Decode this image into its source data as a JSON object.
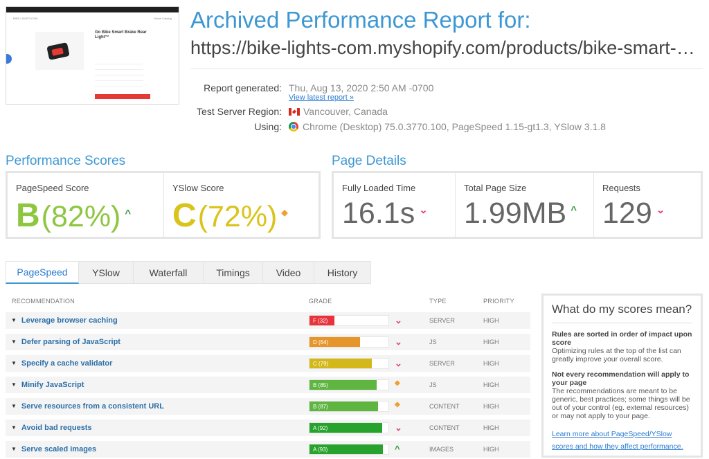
{
  "header": {
    "title": "Archived Performance Report for:",
    "url": "https://bike-lights-com.myshopify.com/products/bike-smart-brake-rear-light",
    "thumbnail": {
      "top_text": "Free shipping for orders over $50",
      "site": "BIKE-LIGHTS.COM",
      "nav": "Home   Catalog",
      "product_title": "Go Bike Smart Brake Rear Light™"
    }
  },
  "meta": {
    "report_generated_label": "Report generated:",
    "report_generated_value": "Thu, Aug 13, 2020 2:50 AM -0700",
    "latest_link": "View latest report »",
    "region_label": "Test Server Region:",
    "region_value": "Vancouver, Canada",
    "using_label": "Using:",
    "using_value": "Chrome (Desktop) 75.0.3770.100, PageSpeed 1.15-gt1.3, YSlow 3.1.8"
  },
  "performance": {
    "title": "Performance Scores",
    "pagespeed": {
      "label": "PageSpeed Score",
      "grade": "B",
      "percent": "(82%)",
      "color": "#8dc63f"
    },
    "yslow": {
      "label": "YSlow Score",
      "grade": "C",
      "percent": "(72%)",
      "color": "#d9c41c"
    }
  },
  "details": {
    "title": "Page Details",
    "loaded": {
      "label": "Fully Loaded Time",
      "value": "16.1s"
    },
    "size": {
      "label": "Total Page Size",
      "value": "1.99MB"
    },
    "requests": {
      "label": "Requests",
      "value": "129"
    }
  },
  "tabs": [
    {
      "label": "PageSpeed",
      "active": true
    },
    {
      "label": "YSlow"
    },
    {
      "label": "Waterfall"
    },
    {
      "label": "Timings"
    },
    {
      "label": "Video"
    },
    {
      "label": "History"
    }
  ],
  "table": {
    "headers": {
      "recommendation": "RECOMMENDATION",
      "grade": "GRADE",
      "type": "TYPE",
      "priority": "PRIORITY"
    },
    "rows": [
      {
        "name": "Leverage browser caching",
        "grade": "F (32)",
        "score": 32,
        "color": "#e8333c",
        "trend": "down",
        "type": "SERVER",
        "priority": "HIGH"
      },
      {
        "name": "Defer parsing of JavaScript",
        "grade": "D (64)",
        "score": 64,
        "color": "#e6952b",
        "trend": "down",
        "type": "JS",
        "priority": "HIGH"
      },
      {
        "name": "Specify a cache validator",
        "grade": "C (79)",
        "score": 79,
        "color": "#d4b81a",
        "trend": "down",
        "type": "SERVER",
        "priority": "HIGH"
      },
      {
        "name": "Minify JavaScript",
        "grade": "B (85)",
        "score": 85,
        "color": "#5eb540",
        "trend": "neutral",
        "type": "JS",
        "priority": "HIGH"
      },
      {
        "name": "Serve resources from a consistent URL",
        "grade": "B (87)",
        "score": 87,
        "color": "#5eb540",
        "trend": "neutral",
        "type": "CONTENT",
        "priority": "HIGH"
      },
      {
        "name": "Avoid bad requests",
        "grade": "A (92)",
        "score": 92,
        "color": "#27a32d",
        "trend": "down",
        "type": "CONTENT",
        "priority": "HIGH"
      },
      {
        "name": "Serve scaled images",
        "grade": "A (93)",
        "score": 93,
        "color": "#27a32d",
        "trend": "up",
        "type": "IMAGES",
        "priority": "HIGH"
      }
    ]
  },
  "side": {
    "title": "What do my scores mean?",
    "h1": "Rules are sorted in order of impact upon score",
    "p1": "Optimizing rules at the top of the list can greatly improve your overall score.",
    "h2": "Not every recommendation will apply to your page",
    "p2": "The recommendations are meant to be generic, best practices; some things will be out of your control (eg. external resources) or may not apply to your page.",
    "link": "Learn more about PageSpeed/YSlow scores and how they affect performance."
  },
  "icons": {
    "up": "arrow-up-icon",
    "down": "arrow-down-icon",
    "neutral": "diamond-icon"
  }
}
